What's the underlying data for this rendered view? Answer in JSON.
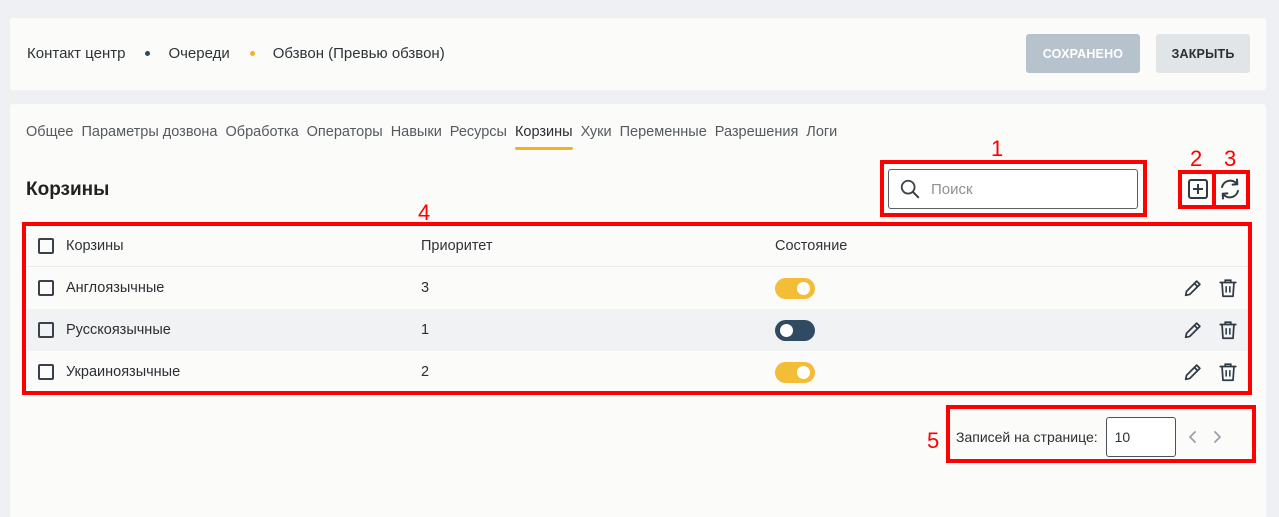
{
  "breadcrumb": [
    "Контакт центр",
    "Очереди",
    "Обзвон (Превью обзвон)"
  ],
  "header_buttons": {
    "saved": "СОХРАНЕНО",
    "close": "ЗАКРЫТЬ"
  },
  "tabs": [
    "Общее",
    "Параметры дозвона",
    "Обработка",
    "Операторы",
    "Навыки",
    "Ресурсы",
    "Корзины",
    "Хуки",
    "Переменные",
    "Разрешения",
    "Логи"
  ],
  "active_tab": "Корзины",
  "page_title": "Корзины",
  "search": {
    "placeholder": "Поиск"
  },
  "table": {
    "columns": [
      "Корзины",
      "Приоритет",
      "Состояние"
    ],
    "rows": [
      {
        "name": "Англоязычные",
        "priority": "3",
        "enabled": true
      },
      {
        "name": "Русскоязычные",
        "priority": "1",
        "enabled": false
      },
      {
        "name": "Украиноязычные",
        "priority": "2",
        "enabled": true
      }
    ]
  },
  "pagination": {
    "label": "Записей на странице:",
    "page_size": "10"
  },
  "annotations": [
    "1",
    "2",
    "3",
    "4",
    "5"
  ],
  "colors": {
    "accent": "#f4b221",
    "toggle_off": "#2f4a61",
    "annotation": "#ff0000",
    "saved_button": "#b6c2cc"
  }
}
